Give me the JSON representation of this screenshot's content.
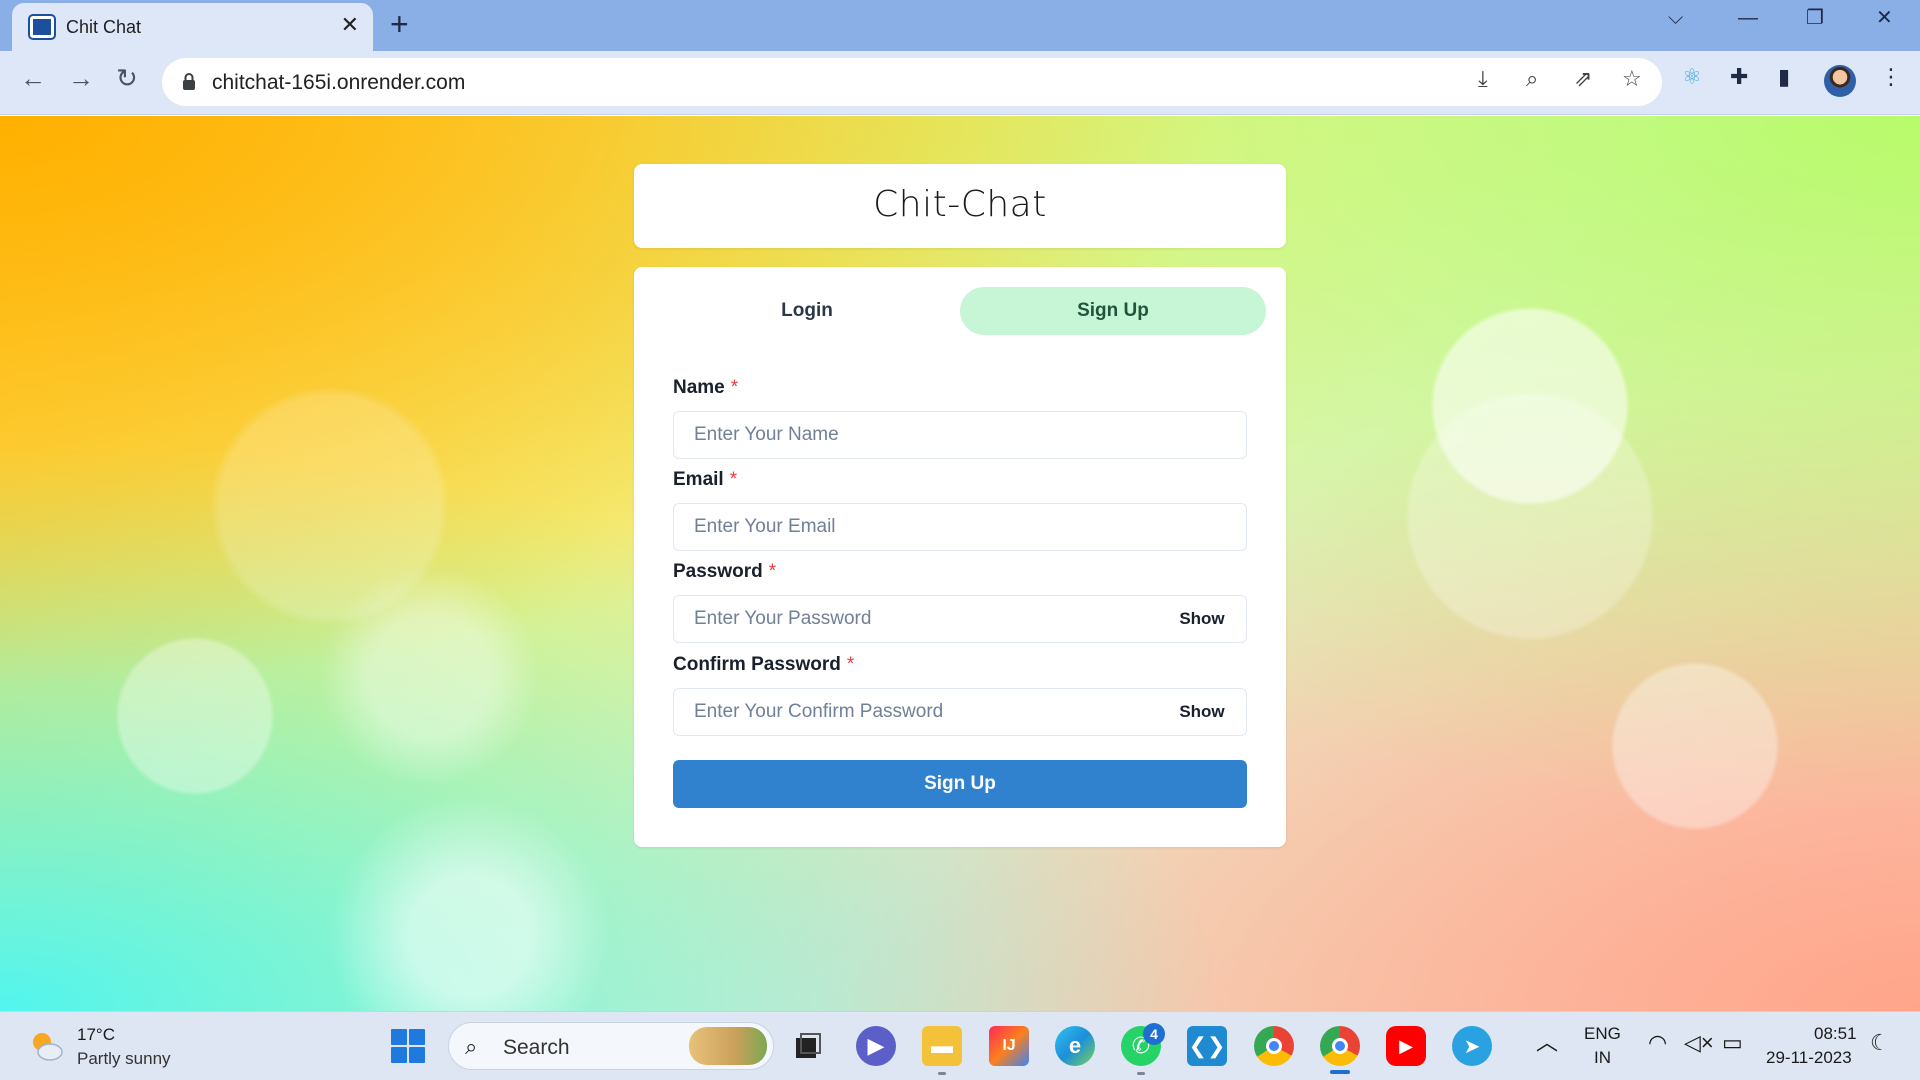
{
  "browser": {
    "tab_title": "Chit Chat",
    "url": "chitchat-165i.onrender.com"
  },
  "page": {
    "app_title": "Chit-Chat",
    "tabs": [
      {
        "label": "Login",
        "active": false
      },
      {
        "label": "Sign Up",
        "active": true
      }
    ],
    "fields": [
      {
        "label": "Name",
        "required_marker": "*",
        "placeholder": "Enter Your Name"
      },
      {
        "label": "Email",
        "required_marker": "*",
        "placeholder": "Enter Your Email"
      },
      {
        "label": "Password",
        "required_marker": "*",
        "placeholder": "Enter Your Password",
        "toggle_label": "Show"
      },
      {
        "label": "Confirm Password",
        "required_marker": "*",
        "placeholder": "Enter Your Confirm Password",
        "toggle_label": "Show"
      }
    ],
    "submit_label": "Sign Up",
    "colors": {
      "accent": "#3182ce",
      "active_tab": "#c6f6d5",
      "required": "#e53e3e"
    }
  },
  "taskbar": {
    "weather_temp": "17°C",
    "weather_desc": "Partly sunny",
    "search_label": "Search",
    "whatsapp_badge": "4",
    "language": "ENG",
    "region": "IN",
    "time": "08:51",
    "date": "29-11-2023",
    "apps": [
      "windows-start-icon",
      "task-view-icon",
      "meet-icon",
      "file-explorer-icon",
      "intellij-icon",
      "edge-icon",
      "whatsapp-icon",
      "vscode-icon",
      "chrome-icon",
      "chrome-profile-icon",
      "youtube-icon",
      "telegram-icon"
    ]
  }
}
